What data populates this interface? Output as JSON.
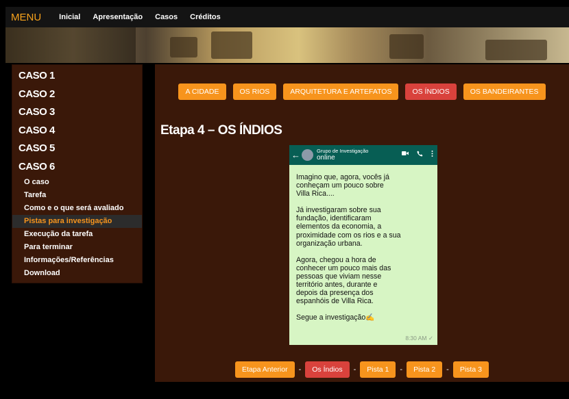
{
  "topbar": {
    "menu_label": "MENU",
    "links": [
      "Inicial",
      "Apresentação",
      "Casos",
      "Créditos"
    ]
  },
  "sidebar": {
    "casos": [
      "CASO 1",
      "CASO 2",
      "CASO 3",
      "CASO 4",
      "CASO 5",
      "CASO 6"
    ],
    "subitems": [
      "O caso",
      "Tarefa",
      "Como e o que será avaliado",
      "Pistas para investigação",
      "Execução da tarefa",
      "Para terminar",
      "Informações/Referências",
      "Download"
    ],
    "active_subitem": "Pistas para investigação"
  },
  "tabs": {
    "items": [
      "A CIDADE",
      "OS RIOS",
      "ARQUITETURA E ARTEFATOS",
      "OS ÍNDIOS",
      "OS BANDEIRANTES"
    ],
    "active": "OS ÍNDIOS"
  },
  "stage_title": "Etapa 4 – OS ÍNDIOS",
  "chat": {
    "group_name": "Grupo de Investigação",
    "status": "online",
    "paragraphs": [
      "Imagino que, agora, vocês já conheçam um pouco sobre Villa Rica....",
      "Já investigaram sobre sua fundação, identificaram elementos da economia, a proximidade com os rios e a sua organização urbana.",
      "Agora, chegou a hora de conhecer um pouco mais das pessoas que viviam nesse território antes, durante e depois da presença dos espanhóis de Villa Rica.",
      "Segue a investigação✍"
    ],
    "time": "8:30 AM ✓"
  },
  "bottom_nav": {
    "items": [
      "Etapa Anterior",
      "Os Índios",
      "Pista 1",
      "Pista 2",
      "Pista 3"
    ],
    "separator": "-",
    "active": "Os Índios"
  },
  "colors": {
    "accent_orange": "#f7941d",
    "active_red": "#d9423c",
    "panel_brown": "#3a1809",
    "chat_green": "#d7f5c4",
    "whatsapp_header": "#075e54"
  },
  "icons": [
    "back-arrow-icon",
    "video-call-icon",
    "phone-icon",
    "more-options-icon"
  ]
}
